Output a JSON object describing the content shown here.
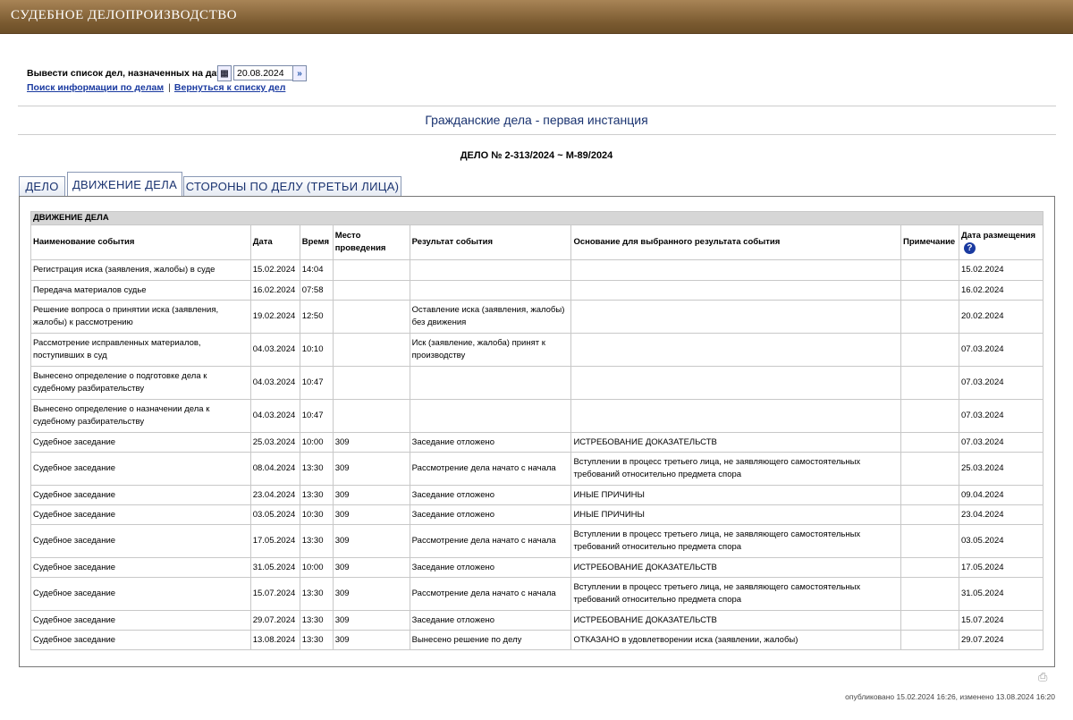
{
  "header": {
    "title": "СУДЕБНОЕ ДЕЛОПРОИЗВОДСТВО"
  },
  "date_filter": {
    "label": "Вывести список дел, назначенных на дату",
    "date_value": "20.08.2024",
    "calendar_icon": "calendar-icon",
    "go_icon": "double-chevron-right-icon"
  },
  "links": {
    "search": "Поиск информации по делам",
    "separator": "|",
    "back": "Вернуться к списку дел"
  },
  "section_title": "Гражданские дела - первая инстанция",
  "case_number": "ДЕЛО № 2-313/2024 ~ М-89/2024",
  "tabs": [
    {
      "label": "ДЕЛО"
    },
    {
      "label": "ДВИЖЕНИЕ ДЕЛА"
    },
    {
      "label": "СТОРОНЫ ПО ДЕЛУ (ТРЕТЬИ ЛИЦА)"
    }
  ],
  "active_tab": "ДВИЖЕНИЕ ДЕЛА",
  "table": {
    "caption": "ДВИЖЕНИЕ ДЕЛА",
    "columns": [
      "Наименование события",
      "Дата",
      "Время",
      "Место проведения",
      "Результат события",
      "Основание для выбранного результата события",
      "Примечание",
      "Дата размещения"
    ],
    "help_icon": "question-circle-icon",
    "rows": [
      [
        "Регистрация иска (заявления, жалобы) в суде",
        "15.02.2024",
        "14:04",
        "",
        "",
        "",
        "",
        "15.02.2024"
      ],
      [
        "Передача материалов судье",
        "16.02.2024",
        "07:58",
        "",
        "",
        "",
        "",
        "16.02.2024"
      ],
      [
        "Решение вопроса о принятии иска (заявления, жалобы) к рассмотрению",
        "19.02.2024",
        "12:50",
        "",
        "Оставление иска (заявления, жалобы) без движения",
        "",
        "",
        "20.02.2024"
      ],
      [
        "Рассмотрение исправленных материалов, поступивших в суд",
        "04.03.2024",
        "10:10",
        "",
        "Иск (заявление, жалоба) принят к производству",
        "",
        "",
        "07.03.2024"
      ],
      [
        "Вынесено определение о подготовке дела к судебному разбирательству",
        "04.03.2024",
        "10:47",
        "",
        "",
        "",
        "",
        "07.03.2024"
      ],
      [
        "Вынесено определение о назначении дела к судебному разбирательству",
        "04.03.2024",
        "10:47",
        "",
        "",
        "",
        "",
        "07.03.2024"
      ],
      [
        "Судебное заседание",
        "25.03.2024",
        "10:00",
        "309",
        "Заседание отложено",
        "ИСТРЕБОВАНИЕ ДОКАЗАТЕЛЬСТВ",
        "",
        "07.03.2024"
      ],
      [
        "Судебное заседание",
        "08.04.2024",
        "13:30",
        "309",
        "Рассмотрение дела начато с начала",
        "Вступлении в процесс третьего лица, не заявляющего самостоятельных требований относительно предмета спора",
        "",
        "25.03.2024"
      ],
      [
        "Судебное заседание",
        "23.04.2024",
        "13:30",
        "309",
        "Заседание отложено",
        "ИНЫЕ ПРИЧИНЫ",
        "",
        "09.04.2024"
      ],
      [
        "Судебное заседание",
        "03.05.2024",
        "10:30",
        "309",
        "Заседание отложено",
        "ИНЫЕ ПРИЧИНЫ",
        "",
        "23.04.2024"
      ],
      [
        "Судебное заседание",
        "17.05.2024",
        "13:30",
        "309",
        "Рассмотрение дела начато с начала",
        "Вступлении в процесс третьего лица, не заявляющего самостоятельных требований относительно предмета спора",
        "",
        "03.05.2024"
      ],
      [
        "Судебное заседание",
        "31.05.2024",
        "10:00",
        "309",
        "Заседание отложено",
        "ИСТРЕБОВАНИЕ ДОКАЗАТЕЛЬСТВ",
        "",
        "17.05.2024"
      ],
      [
        "Судебное заседание",
        "15.07.2024",
        "13:30",
        "309",
        "Рассмотрение дела начато с начала",
        "Вступлении в процесс третьего лица, не заявляющего самостоятельных требований относительно предмета спора",
        "",
        "31.05.2024"
      ],
      [
        "Судебное заседание",
        "29.07.2024",
        "13:30",
        "309",
        "Заседание отложено",
        "ИСТРЕБОВАНИЕ ДОКАЗАТЕЛЬСТВ",
        "",
        "15.07.2024"
      ],
      [
        "Судебное заседание",
        "13.08.2024",
        "13:30",
        "309",
        "Вынесено решение по делу",
        "ОТКАЗАНО в удовлетворении иска (заявлении, жалобы)",
        "",
        "29.07.2024"
      ]
    ]
  },
  "print_icon": "printer-icon",
  "footer": "опубликовано 15.02.2024 16:26, изменено 13.08.2024 16:20"
}
